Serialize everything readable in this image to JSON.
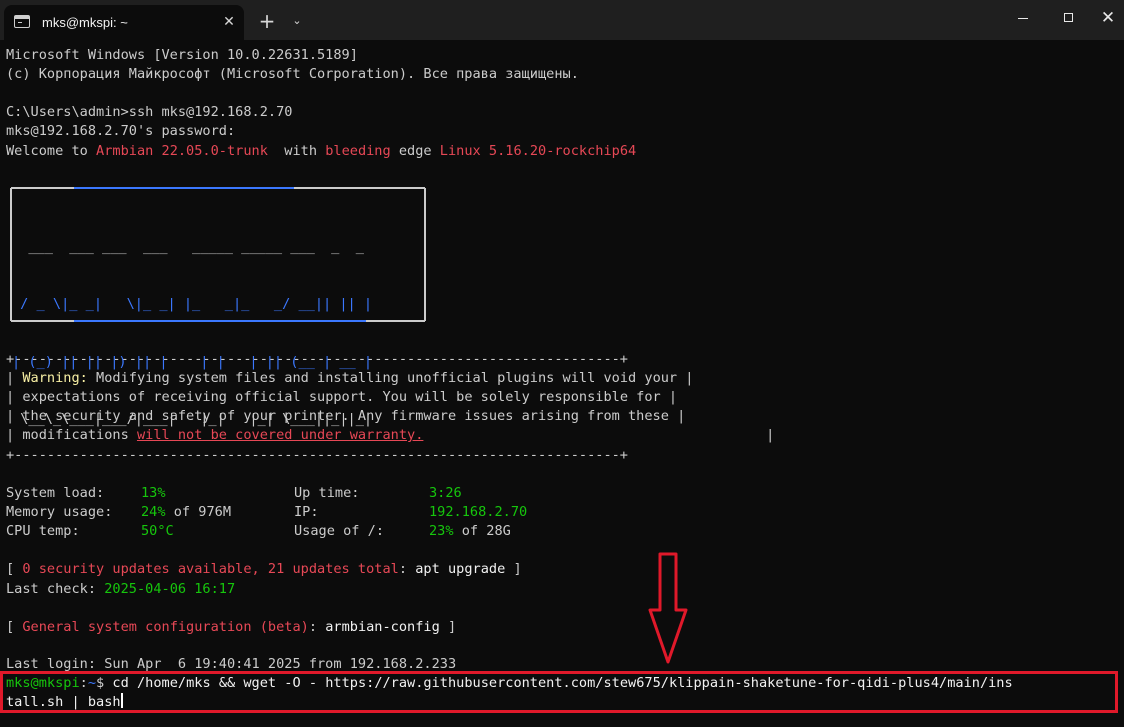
{
  "tab": {
    "title": "mks@mkspi: ~"
  },
  "titlebar": {
    "new_tab": "+",
    "dropdown": "⌄",
    "close_tab": "✕",
    "close_window": "✕"
  },
  "lines": {
    "l1": "Microsoft Windows [Version 10.0.22631.5189]",
    "l2": "(c) Корпорация Майкрософт (Microsoft Corporation). Все права защищены.",
    "l3": "C:\\Users\\admin>ssh mks@192.168.2.70",
    "l4": "mks@192.168.2.70's password:",
    "welcome_a": "Welcome to ",
    "welcome_b": "Armbian 22.05.0-trunk",
    "welcome_c": "  with ",
    "welcome_d": "bleeding",
    "welcome_e": " edge ",
    "welcome_f": "Linux 5.16.20-rockchip64"
  },
  "logo": {
    "row1": "  ___  ___ ___  ___   _____ _____ ___  _  _ ",
    "row2": " / _ \\|_ _|   \\|_ _| |_   _|_   _/ __|| || |",
    "row3": "| (_) || || |) || |    | |   | || (__ | __ |",
    "row4": " \\__\\_\\___|___/|___|   |_|   |_| \\___||_||_|"
  },
  "warning": {
    "border": "+--------------------------------------------------------------------------+",
    "pipe_l": "| ",
    "pipe_r": " |",
    "label": "Warning:",
    "w1": " Modifying system files and installing unofficial plugins will void your",
    "w2": "expectations of receiving official support. You will be solely responsible for",
    "w3": "the security and safety of your printer. Any firmware issues arising from these",
    "w4": "modifications ",
    "w4_link": "will not be covered under warranty."
  },
  "stats": {
    "load_label": "System load:",
    "load_value": "13%",
    "uptime_label": "Up time:",
    "uptime_value": "3:26",
    "mem_label": "Memory usage:",
    "mem_value": "24%",
    "mem_rest": " of 976M",
    "ip_label": "IP:",
    "ip_value": "192.168.2.70",
    "cpu_label": "CPU temp:",
    "cpu_value": "50°C",
    "usage_label": "Usage of /:",
    "usage_value": "23%",
    "usage_rest": " of 28G"
  },
  "updates": {
    "open": "[ ",
    "text": "0 security updates available, 21 updates total",
    "colon": ": ",
    "cmd": "apt upgrade",
    "close": " ]",
    "last_check_label": "Last check: ",
    "last_check_value": "2025-04-06 16:17"
  },
  "config": {
    "open": "[ ",
    "text": "General system configuration (beta)",
    "colon": ": ",
    "cmd": "armbian-config",
    "close": " ]"
  },
  "last_login": "Last login: Sun Apr  6 19:40:41 2025 from 192.168.2.233",
  "prompt": {
    "host": "mks@mkspi",
    "sep": ":",
    "path": "~",
    "dollar": "$ ",
    "cmd_line1": "cd /home/mks && wget -O - https://raw.githubusercontent.com/stew675/klippain-shaketune-for-qidi-plus4/main/ins",
    "cmd_line2": "tall.sh | bash"
  },
  "colors": {
    "highlight_box": "#e0192a",
    "arrow": "#e0192a",
    "prompt_green": "#16c60c",
    "accent_red": "#e74856"
  }
}
